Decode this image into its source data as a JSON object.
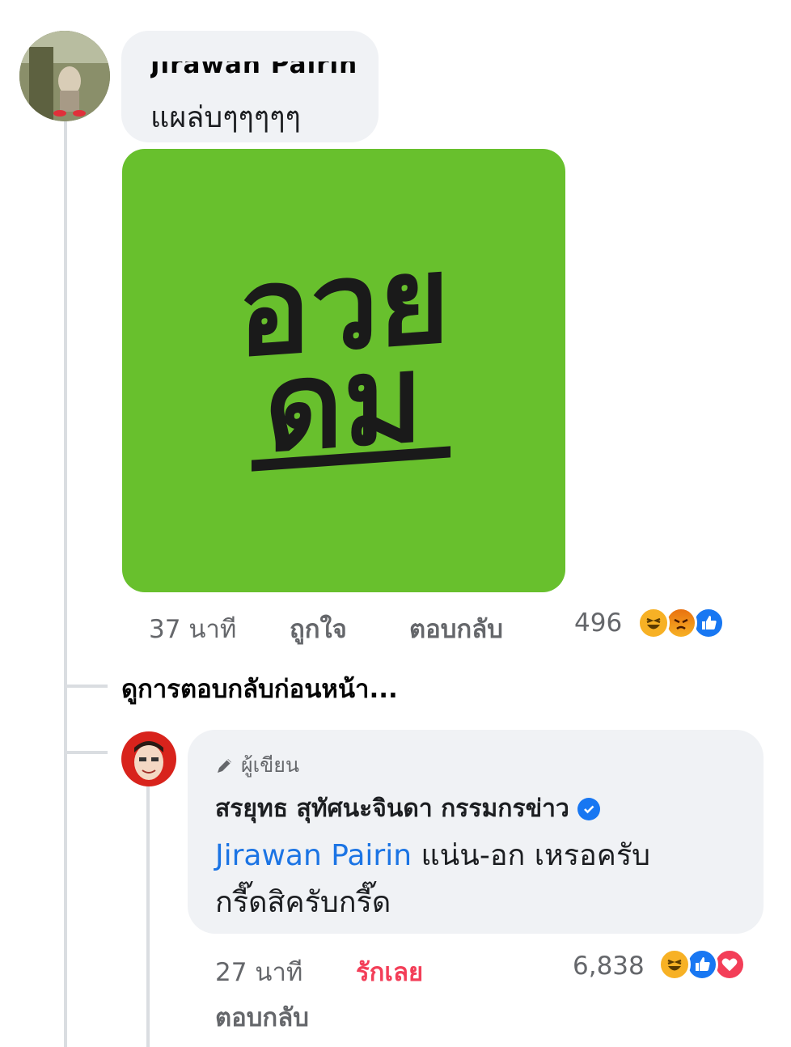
{
  "comment1": {
    "author": "Jirawan Pairin",
    "text": "แผล่บๆๆๆๆๆ",
    "sticker_text_line1": "อวย",
    "sticker_text_line2": "ดม",
    "time": "37 นาที",
    "like_label": "ถูกใจ",
    "reply_label": "ตอบกลับ",
    "reaction_count": "496",
    "reactions": [
      "haha-icon",
      "angry-icon",
      "like-icon"
    ]
  },
  "view_previous_replies": "ดูการตอบกลับก่อนหน้า...",
  "reply1": {
    "author_badge": "ผู้เขียน",
    "author": "สรยุทธ สุทัศนะจินดา กรรมกรข่าว",
    "mention": "Jirawan Pairin",
    "text_line1": " แน่น-อก เหรอครับ",
    "text_line2": "กรี๊ดสิครับกรี๊ด",
    "time": "27 นาที",
    "love_label": "รักเลย",
    "reply_label": "ตอบกลับ",
    "reaction_count": "6,838",
    "reactions": [
      "haha-icon",
      "like-icon",
      "love-icon"
    ],
    "colors": {
      "love": "#f33e58",
      "mention": "#1b74e4",
      "verified": "#1877f2"
    }
  }
}
